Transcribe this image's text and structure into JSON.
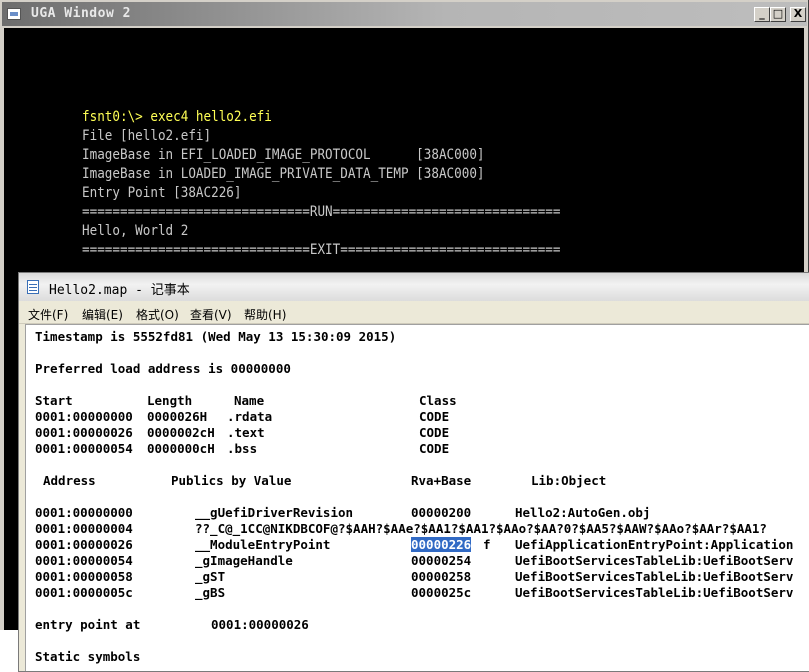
{
  "uga": {
    "title": "UGA Window 2",
    "buttons": {
      "minimize": "_",
      "maximize": "□",
      "close": "X"
    },
    "console": {
      "prompt": "fsnt0:\\> exec4 hello2.efi",
      "file_line": "File [hello2.efi]",
      "imagebase_proto": "ImageBase in EFI_LOADED_IMAGE_PROTOCOL      [38AC000]",
      "imagebase_priv": "ImageBase in LOADED_IMAGE_PRIVATE_DATA_TEMP [38AC000]",
      "entry_point": "Entry Point [38AC226]",
      "run_sep": "==============================RUN==============================",
      "hello": "Hello, World 2",
      "exit_sep": "==============================EXIT============================="
    }
  },
  "notepad": {
    "title": "Hello2.map - 记事本",
    "menu": {
      "file": "文件(F)",
      "edit": "编辑(E)",
      "format": "格式(O)",
      "view": "查看(V)",
      "help": "帮助(H)"
    },
    "content": {
      "timestamp": "Timestamp is 5552fd81 (Wed May 13 15:30:09 2015)",
      "preferred": "Preferred load address is 00000000",
      "sections_header": {
        "start": "Start",
        "length": "Length",
        "name": "Name",
        "class": "Class"
      },
      "sections": [
        {
          "start": "0001:00000000",
          "length": "0000026H",
          "name": ".rdata",
          "class": "CODE"
        },
        {
          "start": "0001:00000026",
          "length": "0000002cH",
          "name": ".text",
          "class": "CODE"
        },
        {
          "start": "0001:00000054",
          "length": "0000000cH",
          "name": ".bss",
          "class": "CODE"
        }
      ],
      "publics_header": {
        "address": "Address",
        "publics": "Publics by Value",
        "rva": "Rva+Base",
        "lib": "Lib:Object"
      },
      "publics": [
        {
          "address": "0001:00000000",
          "name": "__gUefiDriverRevision",
          "rva": "00000200",
          "flag": "",
          "lib": "Hello2:AutoGen.obj"
        },
        {
          "address": "0001:00000004",
          "name": "??_C@_1CC@NIKDBCOF@?$AAH?$AAe?$AA1?$AA1?$AAo?$AA?0?$AA5?$AAW?$AAo?$AAr?$AA1?",
          "rva": "",
          "flag": "",
          "lib": ""
        },
        {
          "address": "0001:00000026",
          "name": "__ModuleEntryPoint",
          "rva": "00000226",
          "flag": "f",
          "lib": "UefiApplicationEntryPoint:Application"
        },
        {
          "address": "0001:00000054",
          "name": "_gImageHandle",
          "rva": "00000254",
          "flag": "",
          "lib": "UefiBootServicesTableLib:UefiBootServ"
        },
        {
          "address": "0001:00000058",
          "name": "_gST",
          "rva": "00000258",
          "flag": "",
          "lib": "UefiBootServicesTableLib:UefiBootServ"
        },
        {
          "address": "0001:0000005c",
          "name": "_gBS",
          "rva": "0000025c",
          "flag": "",
          "lib": "UefiBootServicesTableLib:UefiBootServ"
        }
      ],
      "entry_label": "entry point at",
      "entry_value": "0001:00000026",
      "static_symbols": "Static symbols"
    }
  },
  "colors": {
    "console_text": "#c8c8c8",
    "prompt": "#ffff55",
    "selection": "#316ac5"
  }
}
